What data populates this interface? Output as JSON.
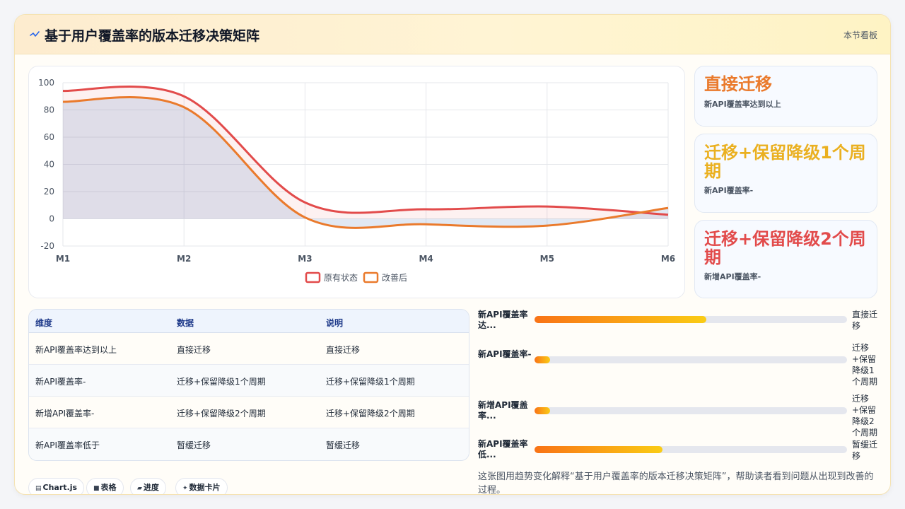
{
  "header": {
    "icon": "trend-line-icon",
    "title": "基于用户覆盖率的版本迁移决策矩阵",
    "link": "本节看板"
  },
  "chart_data": {
    "type": "line",
    "x": [
      "M1",
      "M2",
      "M3",
      "M4",
      "M5",
      "M6"
    ],
    "ylim": [
      -20,
      100
    ],
    "yticks": [
      100,
      80,
      60,
      40,
      20,
      0,
      -20
    ],
    "grid": true,
    "legend_position": "bottom",
    "series": [
      {
        "name": "原有状态",
        "values": [
          94,
          90,
          12,
          7,
          9,
          3
        ],
        "color": "#e24b4b",
        "fill": true
      },
      {
        "name": "改善后",
        "values": [
          86,
          82,
          1,
          -4,
          -5,
          8
        ],
        "color": "#ea7a2c",
        "fill": true
      }
    ]
  },
  "side_cards": [
    {
      "value": "直接迁移",
      "label": "新API覆盖率达到以上",
      "color": "#ea7a2c"
    },
    {
      "value": "迁移+保留降级1个周期",
      "label": "新API覆盖率-",
      "color": "#eab020"
    },
    {
      "value": "迁移+保留降级2个周期",
      "label": "新增API覆盖率-",
      "color": "#e24b4b"
    }
  ],
  "table": {
    "headers": [
      "维度",
      "数据",
      "说明"
    ],
    "rows": [
      [
        "新API覆盖率达到以上",
        "直接迁移",
        "直接迁移"
      ],
      [
        "新API覆盖率-",
        "迁移+保留降级1个周期",
        "迁移+保留降级1个周期"
      ],
      [
        "新增API覆盖率-",
        "迁移+保留降级2个周期",
        "迁移+保留降级2个周期"
      ],
      [
        "新API覆盖率低于",
        "暂缓迁移",
        "暂缓迁移"
      ]
    ]
  },
  "progress": [
    {
      "label": "新API覆盖率达...",
      "value": "直接迁移",
      "fill": 0.55
    },
    {
      "label": "新API覆盖率-",
      "value": "迁移+保留降级1个周期",
      "fill": 0.05
    },
    {
      "label": "新增API覆盖率...",
      "value": "迁移+保留降级2个周期",
      "fill": 0.05
    },
    {
      "label": "新API覆盖率低...",
      "value": "暂缓迁移",
      "fill": 0.41
    }
  ],
  "note": "这张图用趋势变化解释“基于用户覆盖率的版本迁移决策矩阵”，帮助读者看到问题从出现到改善的过程。",
  "chips": [
    {
      "icon": "chart-icon",
      "glyph": "▤",
      "label": "Chart.js"
    },
    {
      "icon": "table-icon",
      "glyph": "■",
      "label": "表格"
    },
    {
      "icon": "progress-icon",
      "glyph": "▰",
      "label": "进度"
    },
    {
      "icon": "spark-icon",
      "glyph": "✦",
      "label": "数据卡片"
    }
  ]
}
